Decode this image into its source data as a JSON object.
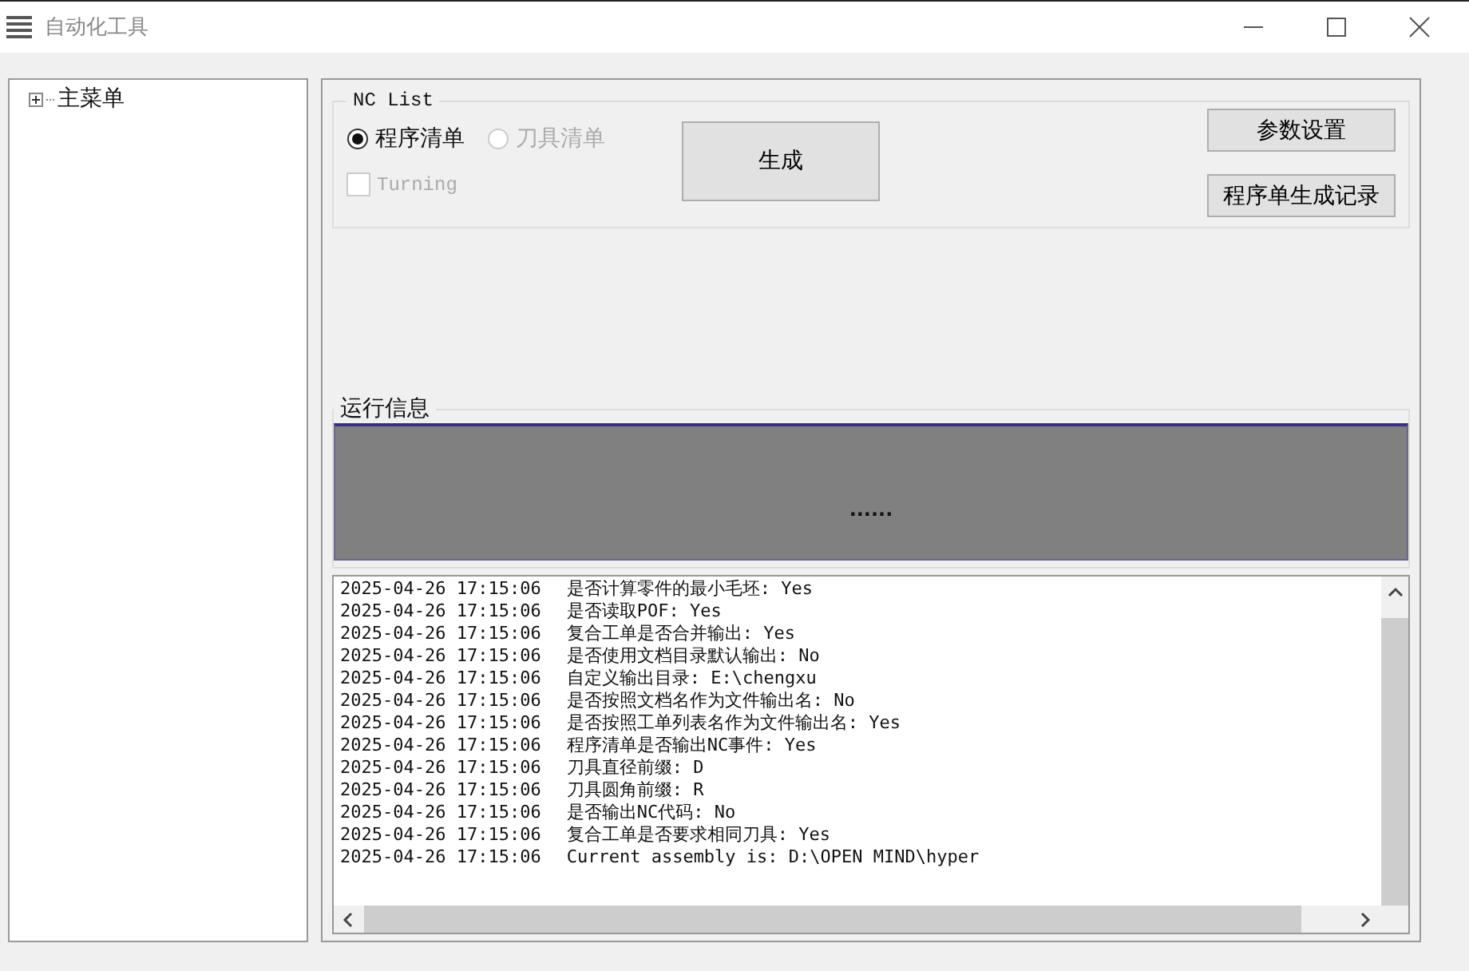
{
  "window": {
    "title": "自动化工具"
  },
  "tree": {
    "items": [
      {
        "label": "主菜单",
        "expanded": false
      }
    ]
  },
  "nc_list": {
    "title": "NC List",
    "radios": [
      {
        "label": "程序清单",
        "selected": true,
        "disabled": false
      },
      {
        "label": "刀具清单",
        "selected": false,
        "disabled": true
      }
    ],
    "checkbox": {
      "label": "Turning",
      "checked": false,
      "disabled": true
    },
    "generate_button": "生成",
    "buttons": [
      "参数设置",
      "程序单生成记录"
    ]
  },
  "run_info": {
    "title": "运行信息",
    "status": "......"
  },
  "log": [
    {
      "time": "2025-04-26 17:15:06",
      "message": "是否计算零件的最小毛坯: Yes"
    },
    {
      "time": "2025-04-26 17:15:06",
      "message": "是否读取POF: Yes"
    },
    {
      "time": "2025-04-26 17:15:06",
      "message": "复合工单是否合并输出: Yes"
    },
    {
      "time": "2025-04-26 17:15:06",
      "message": "是否使用文档目录默认输出: No"
    },
    {
      "time": "2025-04-26 17:15:06",
      "message": "自定义输出目录: E:\\chengxu"
    },
    {
      "time": "2025-04-26 17:15:06",
      "message": "是否按照文档名作为文件输出名: No"
    },
    {
      "time": "2025-04-26 17:15:06",
      "message": "是否按照工单列表名作为文件输出名: Yes"
    },
    {
      "time": "2025-04-26 17:15:06",
      "message": "程序清单是否输出NC事件: Yes"
    },
    {
      "time": "2025-04-26 17:15:06",
      "message": "刀具直径前缀: D"
    },
    {
      "time": "2025-04-26 17:15:06",
      "message": "刀具圆角前缀: R"
    },
    {
      "time": "2025-04-26 17:15:06",
      "message": "是否输出NC代码: No"
    },
    {
      "time": "2025-04-26 17:15:06",
      "message": "复合工单是否要求相同刀具: Yes"
    },
    {
      "time": "2025-04-26 17:15:06",
      "message": "Current assembly is: D:\\OPEN MIND\\hyper"
    }
  ]
}
